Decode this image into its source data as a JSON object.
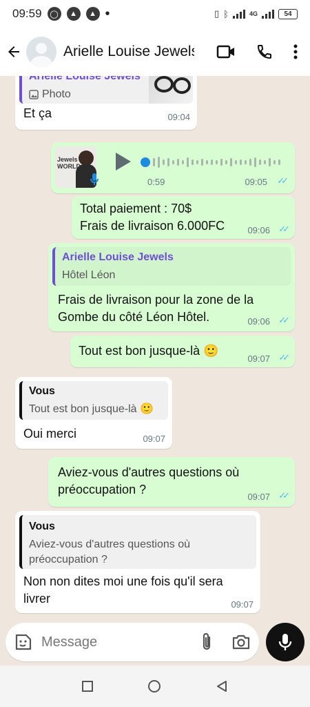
{
  "status_bar": {
    "time": "09:59",
    "network": "4G",
    "battery": "54"
  },
  "header": {
    "contact_name": "Arielle Louise Jewels"
  },
  "messages": {
    "m1": {
      "quote_title": "Arielle Louise Jewels",
      "quote_text": "Photo",
      "text": "Et ça",
      "time": "09:04"
    },
    "m2": {
      "thumb_text": "Jewels WORLD",
      "duration": "0:59",
      "time": "09:05"
    },
    "m3": {
      "line1": "Total paiement : 70$",
      "line2": "Frais de livraison 6.000FC",
      "time": "09:06"
    },
    "m4": {
      "quote_title": "Arielle Louise Jewels",
      "quote_text": "Hôtel Léon",
      "text": "Frais de livraison pour la zone de la Gombe du côté Léon Hôtel.",
      "time": "09:06"
    },
    "m5": {
      "text": "Tout est bon jusque-là 🙂",
      "time": "09:07"
    },
    "m6": {
      "quote_title": "Vous",
      "quote_text": "Tout est bon jusque-là 🙂",
      "text": "Oui merci",
      "time": "09:07"
    },
    "m7": {
      "text": "Aviez-vous d'autres questions où préoccupation ?",
      "time": "09:07"
    },
    "m8": {
      "quote_title": "Vous",
      "quote_text": "Aviez-vous d'autres questions où préoccupation ?",
      "text": "Non non dites moi une fois qu'il sera livrer",
      "time": "09:07"
    }
  },
  "composer": {
    "placeholder": "Message"
  },
  "colors": {
    "outgoing": "#d9fdd3",
    "incoming": "#ffffff",
    "read_ticks": "#53bdeb",
    "quote_accent": "#6c4fd3"
  }
}
